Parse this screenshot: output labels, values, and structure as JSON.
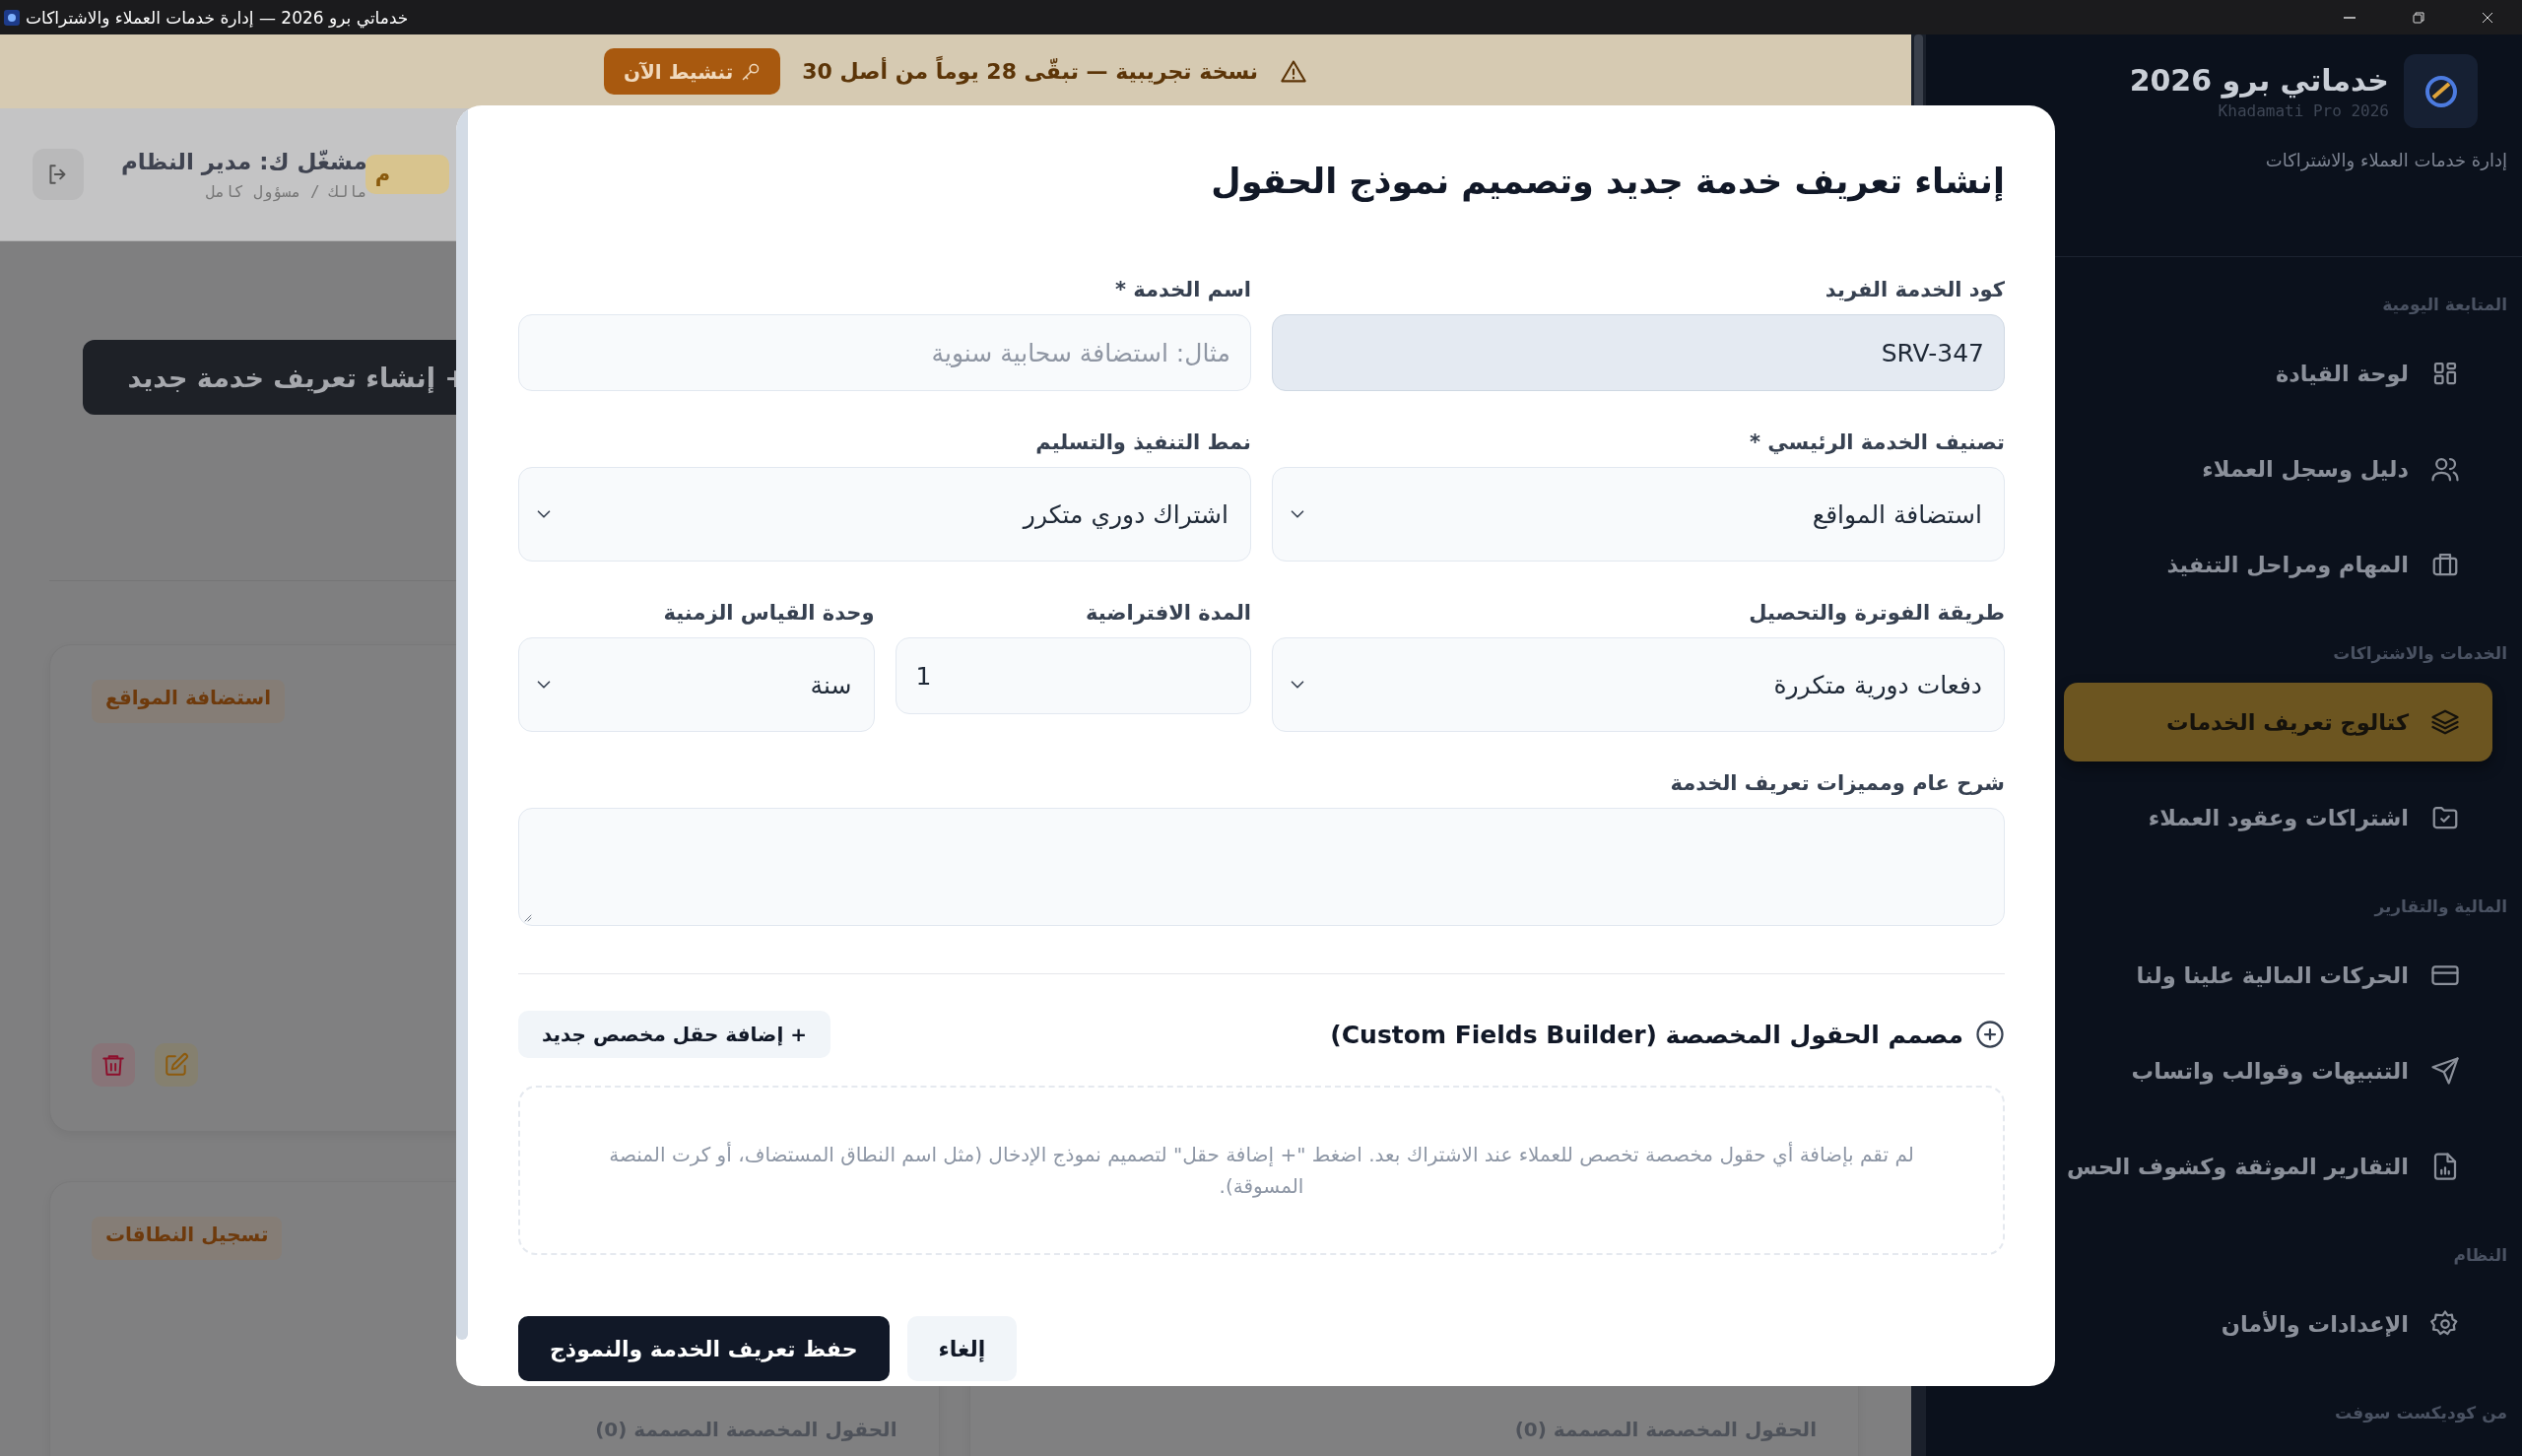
{
  "window": {
    "title": "خدماتي برو 2026 — إدارة خدمات العملاء والاشتراكات"
  },
  "trial_banner": {
    "message": "نسخة تجريبية — تبقّى 28 يوماً من أصل 30",
    "button": "تنشيط الآن"
  },
  "header": {
    "badge": "م",
    "user": "مشغّل ك: مدير النظام",
    "role": "مالك / مسؤول كامل"
  },
  "page": {
    "create_button": "+ إنشاء تعريف خدمة جديد",
    "card_rows": [
      [
        {
          "badge": "استضافة المواقع",
          "actions": true
        }
      ],
      [
        {
          "fields_label": "الحقول المخصصة المصممة (0)"
        },
        {
          "badge": "تسجيل النطاقات",
          "fields_label": "الحقول المخصصة المصممة (0)"
        }
      ]
    ]
  },
  "sidebar": {
    "brand": {
      "name": "خدماتي برو 2026",
      "subtitle": "Khadamati Pro 2026",
      "tagline": "إدارة خدمات العملاء والاشتراكات"
    },
    "sections": [
      {
        "title": "المتابعة اليومية",
        "items": [
          {
            "label": "لوحة القيادة",
            "selected": false
          },
          {
            "label": "دليل وسجل العملاء",
            "selected": false
          },
          {
            "label": "المهام ومراحل التنفيذ",
            "selected": false
          }
        ]
      },
      {
        "title": "الخدمات والاشتراكات",
        "items": [
          {
            "label": "كتالوج تعريف الخدمات",
            "selected": true
          },
          {
            "label": "اشتراكات وعقود العملاء",
            "selected": false
          }
        ]
      },
      {
        "title": "المالية والتقارير",
        "items": [
          {
            "label": "الحركات المالية علينا ولنا",
            "selected": false
          },
          {
            "label": "التنبيهات وقوالب واتساب",
            "selected": false
          },
          {
            "label": "التقارير الموثقة وكشوف الحس",
            "selected": false
          }
        ]
      },
      {
        "title": "النظام",
        "items": [
          {
            "label": "الإعدادات والأمان",
            "selected": false
          }
        ]
      },
      {
        "title": "من كوديكست سوفت"
      }
    ]
  },
  "modal": {
    "title": "إنشاء تعريف خدمة جديد وتصميم نموذج الحقول",
    "rows": [
      [
        {
          "kind": "text",
          "label": "كود الخدمة الفريد",
          "value": "SRV-347",
          "readonly": true
        },
        {
          "kind": "text",
          "label": "اسم الخدمة *",
          "placeholder": "مثال: استضافة سحابية سنوية",
          "readonly": false
        }
      ],
      [
        {
          "kind": "select",
          "label": "تصنيف الخدمة الرئيسي *",
          "value": "استضافة المواقع",
          "readonly": false
        },
        {
          "kind": "select",
          "label": "نمط التنفيذ والتسليم",
          "value": "اشتراك دوري متكرر",
          "readonly": false
        }
      ],
      [
        {
          "kind": "select",
          "label": "طريقة الفوترة والتحصيل",
          "value": "دفعات دورية متكررة",
          "readonly": false
        },
        {
          "kind": "number",
          "label": "المدة الافتراضية",
          "value": "1",
          "readonly": false
        },
        {
          "kind": "select",
          "label": "وحدة القياس الزمنية",
          "value": "سنة",
          "readonly": false
        }
      ],
      [
        {
          "kind": "textarea",
          "label": "شرح عام ومميزات تعريف الخدمة",
          "readonly": false
        }
      ]
    ],
    "builder": {
      "title": "مصمم الحقول المخصصة (Custom Fields Builder)",
      "add_button": "+ إضافة حقل مخصص جديد",
      "empty_text": "لم تقم بإضافة أي حقول مخصصة تخصص للعملاء عند الاشتراك بعد. اضغط \"+ إضافة حقل\" لتصميم نموذج الإدخال (مثل اسم النطاق المستضاف، أو كرت المنصة المسوقة)."
    },
    "buttons": [
      {
        "kind": "secondary",
        "label": "إلغاء"
      },
      {
        "kind": "primary",
        "label": "حفظ تعريف الخدمة والنموذج"
      }
    ]
  }
}
